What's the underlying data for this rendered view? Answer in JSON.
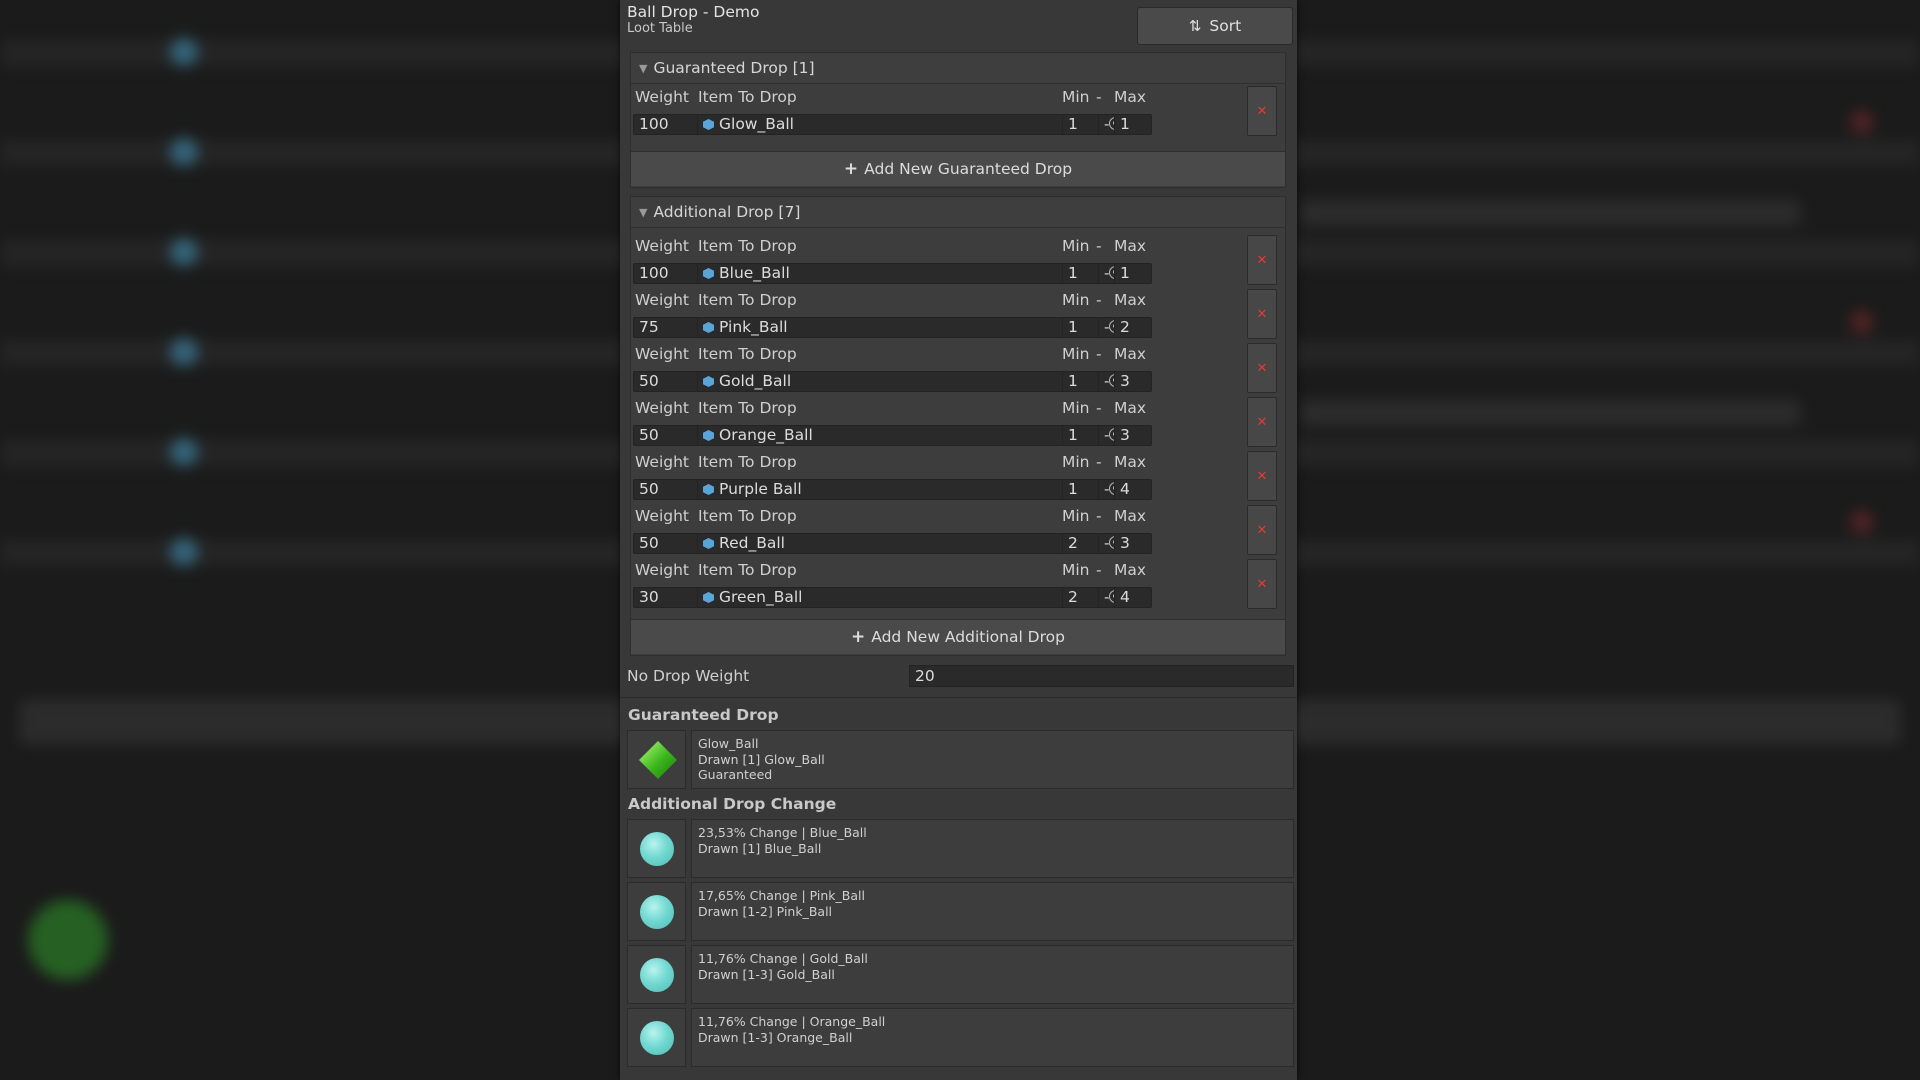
{
  "window": {
    "title": "Ball Drop - Demo",
    "subtitle": "Loot Table",
    "sort_label": "Sort"
  },
  "guaranteed": {
    "header": "Guaranteed Drop [1]",
    "rows": [
      {
        "weight_label": "Weight",
        "item_label": "Item To Drop",
        "min_label": "Min",
        "dash": "-",
        "max_label": "Max",
        "weight": "100",
        "item": "Glow_Ball",
        "min": "1",
        "max": "1"
      }
    ],
    "add_label": "Add New Guaranteed Drop"
  },
  "additional": {
    "header": "Additional Drop [7]",
    "rows": [
      {
        "weight_label": "Weight",
        "item_label": "Item To Drop",
        "min_label": "Min",
        "dash": "-",
        "max_label": "Max",
        "weight": "100",
        "item": "Blue_Ball",
        "min": "1",
        "max": "1"
      },
      {
        "weight_label": "Weight",
        "item_label": "Item To Drop",
        "min_label": "Min",
        "dash": "-",
        "max_label": "Max",
        "weight": "75",
        "item": "Pink_Ball",
        "min": "1",
        "max": "2"
      },
      {
        "weight_label": "Weight",
        "item_label": "Item To Drop",
        "min_label": "Min",
        "dash": "-",
        "max_label": "Max",
        "weight": "50",
        "item": "Gold_Ball",
        "min": "1",
        "max": "3"
      },
      {
        "weight_label": "Weight",
        "item_label": "Item To Drop",
        "min_label": "Min",
        "dash": "-",
        "max_label": "Max",
        "weight": "50",
        "item": "Orange_Ball",
        "min": "1",
        "max": "3"
      },
      {
        "weight_label": "Weight",
        "item_label": "Item To Drop",
        "min_label": "Min",
        "dash": "-",
        "max_label": "Max",
        "weight": "50",
        "item": "Purple Ball",
        "min": "1",
        "max": "4"
      },
      {
        "weight_label": "Weight",
        "item_label": "Item To Drop",
        "min_label": "Min",
        "dash": "-",
        "max_label": "Max",
        "weight": "50",
        "item": "Red_Ball",
        "min": "2",
        "max": "3"
      },
      {
        "weight_label": "Weight",
        "item_label": "Item To Drop",
        "min_label": "Min",
        "dash": "-",
        "max_label": "Max",
        "weight": "30",
        "item": "Green_Ball",
        "min": "2",
        "max": "4"
      }
    ],
    "add_label": "Add New Additional Drop"
  },
  "no_drop": {
    "label": "No Drop Weight",
    "value": "20"
  },
  "preview": {
    "guaranteed_title": "Guaranteed Drop",
    "guaranteed_card": {
      "line1": "Glow_Ball",
      "line2": "Drawn [1] Glow_Ball",
      "line3": "Guaranteed"
    },
    "additional_title": "Additional Drop Change",
    "additional_cards": [
      {
        "line1": "23,53% Change | Blue_Ball",
        "line2": "Drawn [1] Blue_Ball"
      },
      {
        "line1": "17,65% Change | Pink_Ball",
        "line2": "Drawn [1-2] Pink_Ball"
      },
      {
        "line1": "11,76% Change | Gold_Ball",
        "line2": "Drawn [1-3] Gold_Ball"
      },
      {
        "line1": "11,76% Change | Orange_Ball",
        "line2": "Drawn [1-3] Orange_Ball"
      }
    ]
  },
  "icons": {
    "sort": "sort-icon",
    "remove": "remove-x-icon",
    "add": "plus-icon",
    "picker": "object-picker-icon",
    "item": "prefab-cube-icon"
  },
  "colors": {
    "panel": "#383838",
    "remove": "#e23a3a",
    "ball": "#74d9d2",
    "gem": "#39b51a"
  }
}
